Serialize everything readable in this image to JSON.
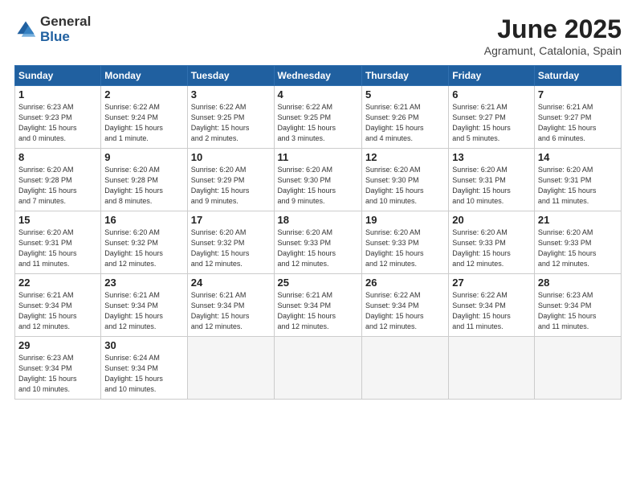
{
  "logo": {
    "general": "General",
    "blue": "Blue"
  },
  "title": {
    "month": "June 2025",
    "location": "Agramunt, Catalonia, Spain"
  },
  "headers": [
    "Sunday",
    "Monday",
    "Tuesday",
    "Wednesday",
    "Thursday",
    "Friday",
    "Saturday"
  ],
  "weeks": [
    [
      {
        "day": "1",
        "sunrise": "6:23 AM",
        "sunset": "9:23 PM",
        "daylight": "15 hours and 0 minutes."
      },
      {
        "day": "2",
        "sunrise": "6:22 AM",
        "sunset": "9:24 PM",
        "daylight": "15 hours and 1 minute."
      },
      {
        "day": "3",
        "sunrise": "6:22 AM",
        "sunset": "9:25 PM",
        "daylight": "15 hours and 2 minutes."
      },
      {
        "day": "4",
        "sunrise": "6:22 AM",
        "sunset": "9:25 PM",
        "daylight": "15 hours and 3 minutes."
      },
      {
        "day": "5",
        "sunrise": "6:21 AM",
        "sunset": "9:26 PM",
        "daylight": "15 hours and 4 minutes."
      },
      {
        "day": "6",
        "sunrise": "6:21 AM",
        "sunset": "9:27 PM",
        "daylight": "15 hours and 5 minutes."
      },
      {
        "day": "7",
        "sunrise": "6:21 AM",
        "sunset": "9:27 PM",
        "daylight": "15 hours and 6 minutes."
      }
    ],
    [
      {
        "day": "8",
        "sunrise": "6:20 AM",
        "sunset": "9:28 PM",
        "daylight": "15 hours and 7 minutes."
      },
      {
        "day": "9",
        "sunrise": "6:20 AM",
        "sunset": "9:28 PM",
        "daylight": "15 hours and 8 minutes."
      },
      {
        "day": "10",
        "sunrise": "6:20 AM",
        "sunset": "9:29 PM",
        "daylight": "15 hours and 9 minutes."
      },
      {
        "day": "11",
        "sunrise": "6:20 AM",
        "sunset": "9:30 PM",
        "daylight": "15 hours and 9 minutes."
      },
      {
        "day": "12",
        "sunrise": "6:20 AM",
        "sunset": "9:30 PM",
        "daylight": "15 hours and 10 minutes."
      },
      {
        "day": "13",
        "sunrise": "6:20 AM",
        "sunset": "9:31 PM",
        "daylight": "15 hours and 10 minutes."
      },
      {
        "day": "14",
        "sunrise": "6:20 AM",
        "sunset": "9:31 PM",
        "daylight": "15 hours and 11 minutes."
      }
    ],
    [
      {
        "day": "15",
        "sunrise": "6:20 AM",
        "sunset": "9:31 PM",
        "daylight": "15 hours and 11 minutes."
      },
      {
        "day": "16",
        "sunrise": "6:20 AM",
        "sunset": "9:32 PM",
        "daylight": "15 hours and 12 minutes."
      },
      {
        "day": "17",
        "sunrise": "6:20 AM",
        "sunset": "9:32 PM",
        "daylight": "15 hours and 12 minutes."
      },
      {
        "day": "18",
        "sunrise": "6:20 AM",
        "sunset": "9:33 PM",
        "daylight": "15 hours and 12 minutes."
      },
      {
        "day": "19",
        "sunrise": "6:20 AM",
        "sunset": "9:33 PM",
        "daylight": "15 hours and 12 minutes."
      },
      {
        "day": "20",
        "sunrise": "6:20 AM",
        "sunset": "9:33 PM",
        "daylight": "15 hours and 12 minutes."
      },
      {
        "day": "21",
        "sunrise": "6:20 AM",
        "sunset": "9:33 PM",
        "daylight": "15 hours and 12 minutes."
      }
    ],
    [
      {
        "day": "22",
        "sunrise": "6:21 AM",
        "sunset": "9:34 PM",
        "daylight": "15 hours and 12 minutes."
      },
      {
        "day": "23",
        "sunrise": "6:21 AM",
        "sunset": "9:34 PM",
        "daylight": "15 hours and 12 minutes."
      },
      {
        "day": "24",
        "sunrise": "6:21 AM",
        "sunset": "9:34 PM",
        "daylight": "15 hours and 12 minutes."
      },
      {
        "day": "25",
        "sunrise": "6:21 AM",
        "sunset": "9:34 PM",
        "daylight": "15 hours and 12 minutes."
      },
      {
        "day": "26",
        "sunrise": "6:22 AM",
        "sunset": "9:34 PM",
        "daylight": "15 hours and 12 minutes."
      },
      {
        "day": "27",
        "sunrise": "6:22 AM",
        "sunset": "9:34 PM",
        "daylight": "15 hours and 11 minutes."
      },
      {
        "day": "28",
        "sunrise": "6:23 AM",
        "sunset": "9:34 PM",
        "daylight": "15 hours and 11 minutes."
      }
    ],
    [
      {
        "day": "29",
        "sunrise": "6:23 AM",
        "sunset": "9:34 PM",
        "daylight": "15 hours and 10 minutes."
      },
      {
        "day": "30",
        "sunrise": "6:24 AM",
        "sunset": "9:34 PM",
        "daylight": "15 hours and 10 minutes."
      },
      null,
      null,
      null,
      null,
      null
    ]
  ],
  "labels": {
    "sunrise": "Sunrise:",
    "sunset": "Sunset:",
    "daylight": "Daylight:"
  }
}
